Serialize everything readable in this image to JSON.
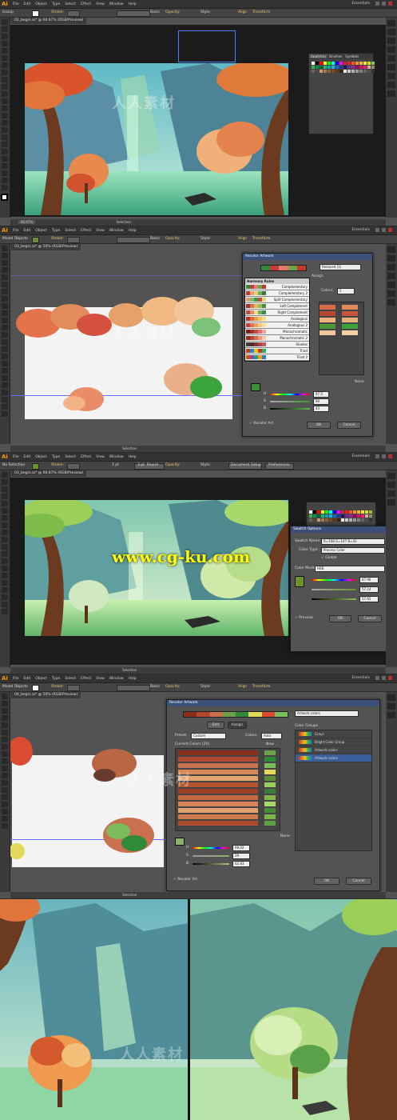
{
  "colors": {
    "accent": "#ff9a00",
    "titlebar": "#3a4f7a",
    "canvas_bg": "#535353"
  },
  "panel1": {
    "menu": [
      "File",
      "Edit",
      "Object",
      "Type",
      "Select",
      "Effect",
      "View",
      "Window",
      "Help"
    ],
    "essentials": "Essentials",
    "selection_label": "Group",
    "stroke_label": "Stroke:",
    "basic_label": "Basic",
    "opacity_label": "Opacity:",
    "style_label": "Style:",
    "align_label": "Align",
    "transform_label": "Transform",
    "doc_tab": "02_begin.ai* @ 66.67% (RGB/Preview)",
    "zoom": "66.67%",
    "status": "Selection",
    "swatches_tabs": [
      "Swatches",
      "Brushes",
      "Symbols"
    ]
  },
  "panel2": {
    "selection_label": "Mixed Objects",
    "doc_tab": "03_begin.ai* @ 50% (RGB/Preview)",
    "status": "Selection",
    "dialog_title": "Recolor Artwork",
    "reduced": "Reduced (1)",
    "assign_label": "Assign",
    "colors_label": "Colors:",
    "colors_value": "5",
    "harmony_header": "Harmony Rules",
    "harmony_rules": [
      {
        "name": "Complementary",
        "chips": [
          "#2e8b3e",
          "#c23a3a",
          "#e07b6b",
          "#6fa14b",
          "#c0392b"
        ]
      },
      {
        "name": "Complementary 2",
        "chips": [
          "#c0392b",
          "#e5a07b",
          "#f0c76a",
          "#6fae5c",
          "#3a7b3a"
        ]
      },
      {
        "name": "Split Complementary",
        "chips": [
          "#e59b6a",
          "#7cc07a",
          "#3f9b3f",
          "#c94a3e",
          "#e8d37a"
        ]
      },
      {
        "name": "Left Complement",
        "chips": [
          "#a03232",
          "#d17650",
          "#e8b05f",
          "#8fbf61",
          "#4b8a3b"
        ]
      },
      {
        "name": "Right Complement",
        "chips": [
          "#c24b3e",
          "#e18a6f",
          "#f3d681",
          "#6fae5c",
          "#3c8b4e"
        ]
      },
      {
        "name": "Analogous",
        "chips": [
          "#b9322c",
          "#da6c3c",
          "#e79a4e",
          "#f0c45e",
          "#f5dc7e"
        ]
      },
      {
        "name": "Analogous 2",
        "chips": [
          "#c43c3c",
          "#e07050",
          "#f0a060",
          "#f5c878",
          "#f8e29a"
        ]
      },
      {
        "name": "Monochromatic",
        "chips": [
          "#7a1f1f",
          "#a12f2f",
          "#c84747",
          "#e27070",
          "#f3a3a3"
        ]
      },
      {
        "name": "Monochromatic 2",
        "chips": [
          "#8a2f1e",
          "#b24731",
          "#d36b4f",
          "#e99a7c",
          "#f6c7b3"
        ]
      },
      {
        "name": "Shades",
        "chips": [
          "#3a3a3a",
          "#5a2a2a",
          "#7d3a3a",
          "#a24a4a",
          "#c65a5a"
        ]
      },
      {
        "name": "Triad",
        "chips": [
          "#c0392b",
          "#2e86c1",
          "#f1c40f",
          "#c0392b",
          "#27ae60"
        ]
      },
      {
        "name": "Triad 2",
        "chips": [
          "#d35400",
          "#8e44ad",
          "#16a085",
          "#f39c12",
          "#2980b9"
        ]
      }
    ],
    "sliders": [
      {
        "label": "H",
        "value": "97.5"
      },
      {
        "label": "S",
        "value": "90"
      },
      {
        "label": "B",
        "value": "43"
      }
    ],
    "none_label": "None",
    "recolor_label": "Recolor Art",
    "ok": "OK",
    "cancel": "Cancel"
  },
  "panel3": {
    "selection_label": "No Selection",
    "doc_tab": "03_begin.ai* @ 66.67% (RGB/Preview)",
    "stroke_value": "1 pt",
    "round_label": "3 pt. Round",
    "doc_setup": "Document Setup",
    "preferences": "Preferences",
    "status": "Selection",
    "dialog_title": "Swatch Options",
    "swatch_name_label": "Swatch Name:",
    "swatch_name_value": "R=108 G=147 B=43",
    "color_type_label": "Color Type:",
    "color_type_value": "Process Color",
    "global_label": "Global",
    "color_mode_label": "Color Mode:",
    "color_mode_value": "HSB",
    "h": "87.96",
    "s": "57.14",
    "b": "57.65",
    "preview_label": "Preview",
    "ok": "OK",
    "cancel": "Cancel",
    "watermark": "www.cg-ku.com"
  },
  "panel4": {
    "selection_label": "Mixed Objects",
    "doc_tab": "04_begin.ai* @ 50% (RGB/Preview)",
    "status": "Selection",
    "dialog_title": "Recolor Artwork",
    "group_name": "Artwork colors",
    "edit_tab": "Edit",
    "assign_tab": "Assign",
    "preset_label": "Preset:",
    "preset_value": "Custom",
    "colors_label": "Colors:",
    "colors_value": "Auto",
    "current_colors": "Current Colors (20)",
    "new_label": "New",
    "color_groups_label": "Color Groups",
    "groups": [
      "Grays",
      "Bright Color Group",
      "Artwork colors",
      "Artwork colors"
    ],
    "sliders": [
      {
        "label": "H",
        "value": "68.02"
      },
      {
        "label": "S",
        "value": "29"
      },
      {
        "label": "B",
        "value": "62.83"
      }
    ],
    "none_label": "None",
    "recolor_label": "Recolor Art",
    "ok": "OK",
    "cancel": "Cancel"
  },
  "watermark_text": "人人素材"
}
